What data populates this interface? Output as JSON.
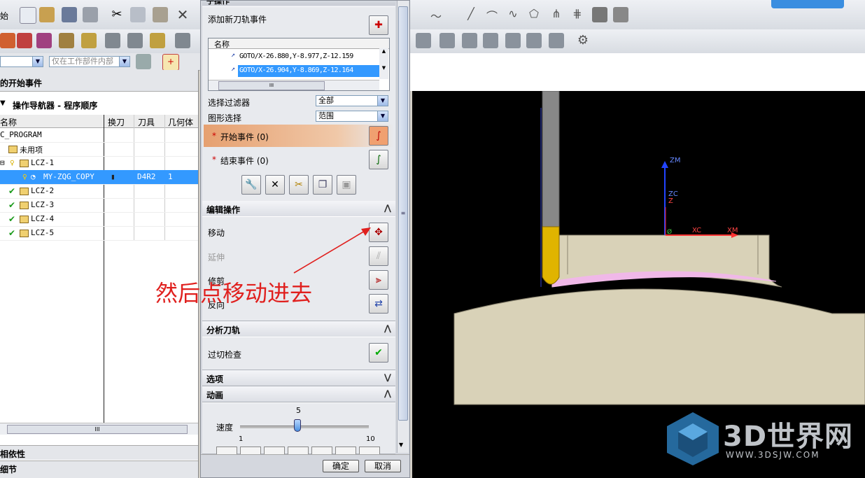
{
  "top_left_fragment": "始",
  "filter_combo": "仅在工作部件内部",
  "nav": {
    "start_event_title": "的开始事件",
    "navigator_title": "操作导航器 - 程序顺序",
    "columns": [
      "名称",
      "换刀",
      "刀具",
      "几何体"
    ],
    "rows": [
      {
        "name": "C_PROGRAM"
      },
      {
        "name": "未用项"
      },
      {
        "name": "LCZ-1"
      },
      {
        "name": "MY-ZQG_COPY",
        "tool": "D4R2",
        "geom": "1"
      },
      {
        "name": "LCZ-2"
      },
      {
        "name": "LCZ-3"
      },
      {
        "name": "LCZ-4"
      },
      {
        "name": "LCZ-5"
      }
    ],
    "scroll_mid": "III",
    "bottom_panels": [
      "相依性",
      "细节"
    ]
  },
  "dialog": {
    "title_fragment": "子操作",
    "add_event_label": "添加新刀轨事件",
    "list_header": "名称",
    "list_items": [
      "GOTO/X-26.880,Y-8.977,Z-12.159",
      "GOTO/X-26.904,Y-8.869,Z-12.164"
    ],
    "list_scroll_mid": "III",
    "filter_label": "选择过滤器",
    "filter_value": "全部",
    "shape_label": "图形选择",
    "shape_value": "范围",
    "start_event": "开始事件 (0)",
    "end_event": "结束事件 (0)",
    "edit_section": "编辑操作",
    "edit_items": [
      "移动",
      "延伸",
      "修剪",
      "反向"
    ],
    "analyze_section": "分析刀轨",
    "overcut_label": "过切检查",
    "options_section": "选项",
    "animation_section": "动画",
    "speed_label": "速度",
    "speed_value": "5",
    "speed_min": "1",
    "speed_max": "10",
    "speed_fraction": 0.44,
    "ok": "确定",
    "cancel": "取消"
  },
  "view": {
    "axes": {
      "zm": "ZM",
      "zc": "ZC",
      "z": "Z",
      "xc": "XC",
      "xm": "XM",
      "origin": "Ø"
    },
    "watermark_big": "3D世界网",
    "watermark_url": "WWW.3DSJW.COM"
  },
  "annotation": "然后点移动进去",
  "colors": {
    "accent_red": "#e0201e",
    "selection_blue": "#3399ff",
    "part_tan": "#d9d2b8",
    "tool_yellow": "#e0b400"
  }
}
